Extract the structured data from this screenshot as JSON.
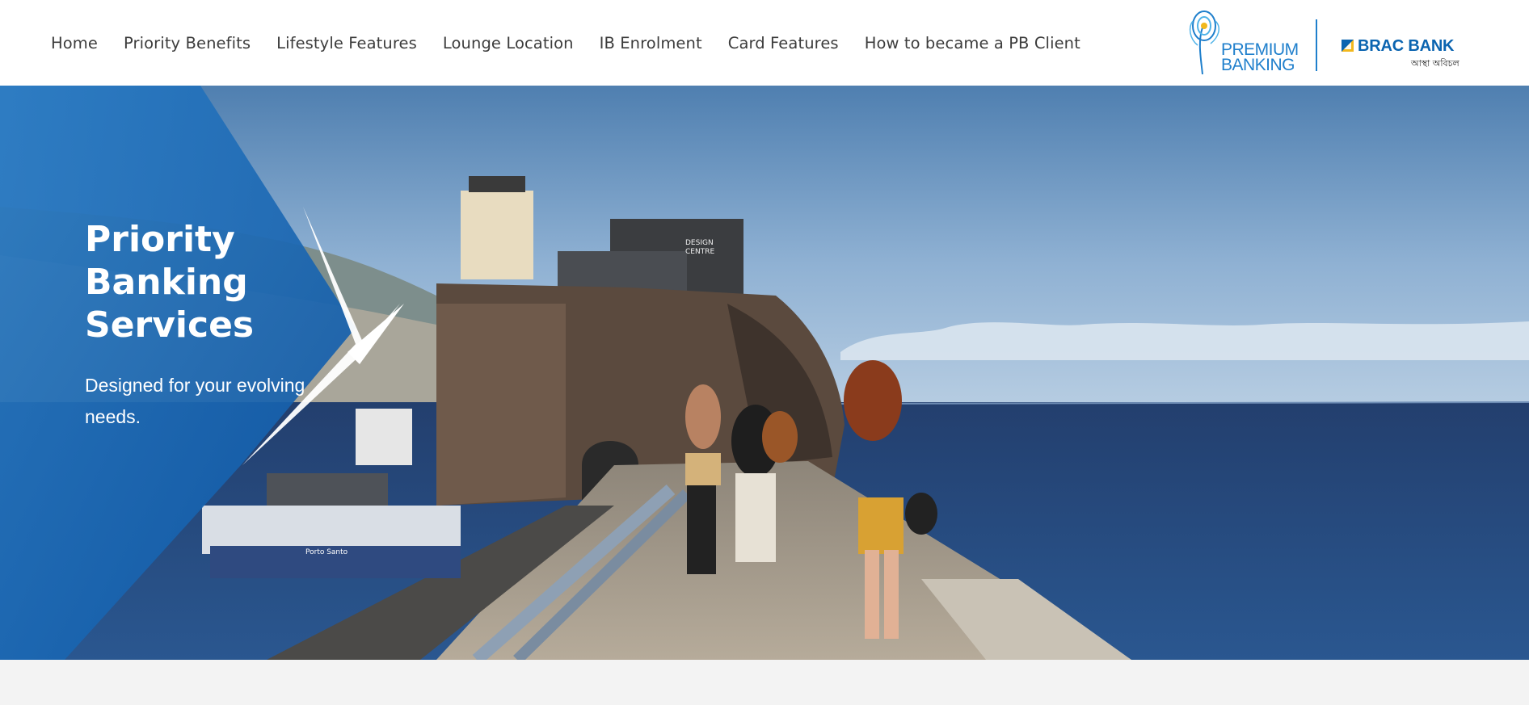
{
  "nav": {
    "items": [
      {
        "label": "Home"
      },
      {
        "label": "Priority Benefits"
      },
      {
        "label": "Lifestyle Features"
      },
      {
        "label": "Lounge Location"
      },
      {
        "label": "IB Enrolment"
      },
      {
        "label": "Card Features"
      },
      {
        "label": "How to became a PB Client"
      }
    ]
  },
  "logos": {
    "premium_banking_line1": "PREMIUM",
    "premium_banking_line2": "BANKING",
    "brac_bank": "BRAC BANK",
    "brac_tagline": "আস্থা অবিচল"
  },
  "hero": {
    "title_line1": "Priority",
    "title_line2": "Banking",
    "title_line3": "Services",
    "subtitle_line1": "Designed for your evolving",
    "subtitle_line2": "needs.",
    "signs": {
      "building_sign_1": "DESIGN",
      "building_sign_2": "CENTRE",
      "ferry_sign": "Porto Santo"
    }
  },
  "colors": {
    "accent_blue": "#1f7fcc",
    "brand_blue": "#0b64b0",
    "nav_text": "#3c3c3c",
    "overlay_blue": "#1565b5"
  }
}
